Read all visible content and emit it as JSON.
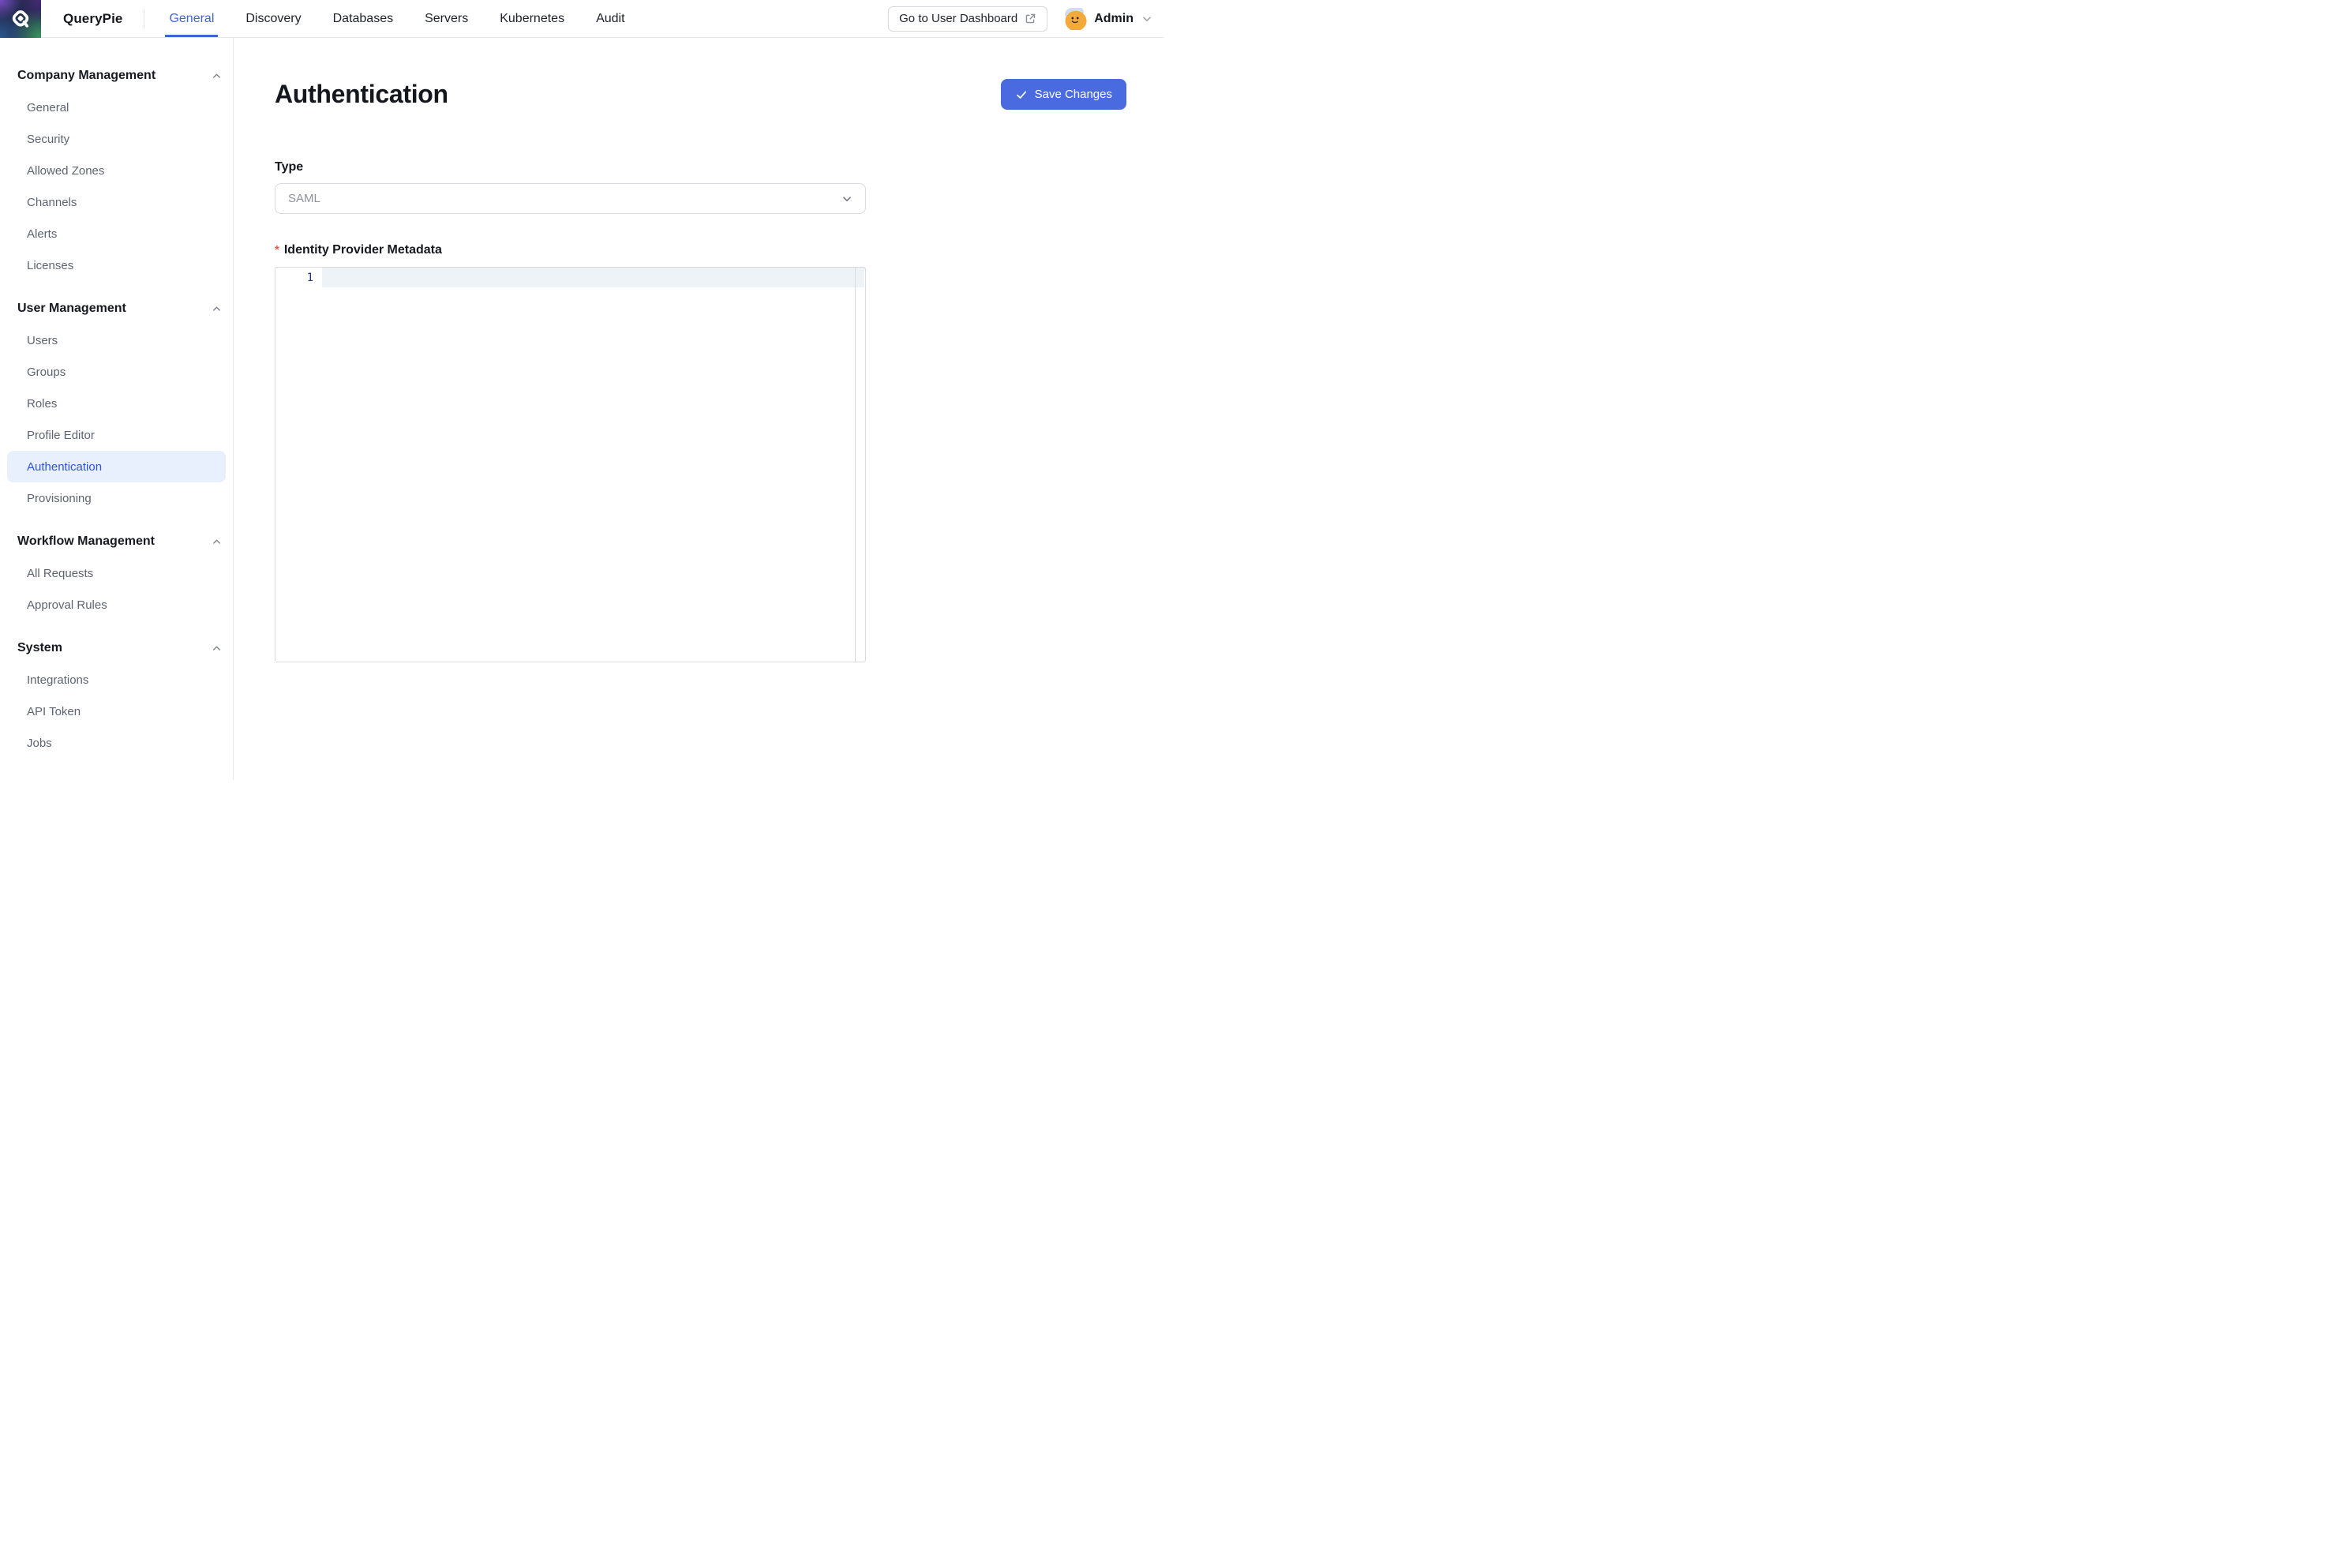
{
  "topbar": {
    "brand": "QueryPie",
    "nav": [
      {
        "label": "General",
        "active": true
      },
      {
        "label": "Discovery",
        "active": false
      },
      {
        "label": "Databases",
        "active": false
      },
      {
        "label": "Servers",
        "active": false
      },
      {
        "label": "Kubernetes",
        "active": false
      },
      {
        "label": "Audit",
        "active": false
      }
    ],
    "dashboard_button_label": "Go to User Dashboard",
    "user_label": "Admin"
  },
  "sidebar": {
    "sections": [
      {
        "title": "Company Management",
        "items": [
          {
            "label": "General"
          },
          {
            "label": "Security"
          },
          {
            "label": "Allowed Zones"
          },
          {
            "label": "Channels"
          },
          {
            "label": "Alerts"
          },
          {
            "label": "Licenses"
          }
        ]
      },
      {
        "title": "User Management",
        "items": [
          {
            "label": "Users"
          },
          {
            "label": "Groups"
          },
          {
            "label": "Roles"
          },
          {
            "label": "Profile Editor"
          },
          {
            "label": "Authentication",
            "active": true
          },
          {
            "label": "Provisioning"
          }
        ]
      },
      {
        "title": "Workflow Management",
        "items": [
          {
            "label": "All Requests"
          },
          {
            "label": "Approval Rules"
          }
        ]
      },
      {
        "title": "System",
        "items": [
          {
            "label": "Integrations"
          },
          {
            "label": "API Token"
          },
          {
            "label": "Jobs"
          }
        ]
      }
    ]
  },
  "main": {
    "title": "Authentication",
    "save_button_label": "Save Changes",
    "form": {
      "type_label": "Type",
      "type_value": "SAML",
      "metadata_required_mark": "*",
      "metadata_label": "Identity Provider Metadata",
      "editor": {
        "line_number": "1",
        "content": ""
      }
    }
  },
  "icons": {
    "logo": "querypie-logo",
    "save": "check-icon",
    "dashboard": "external-link-icon",
    "select": "chevron-down-icon",
    "user_menu": "chevron-down-icon",
    "section_toggle": "chevron-up-icon"
  },
  "colors": {
    "accent_blue": "#3e63dd",
    "save_button_blue": "#4a6be0",
    "active_item_text": "#2f55d4",
    "active_item_bg": "#e8effd",
    "active_line_bg": "#eef3f8",
    "line_number_navy": "#24307a",
    "required_red": "#e25950",
    "border_gray": "#e7e8ea"
  }
}
